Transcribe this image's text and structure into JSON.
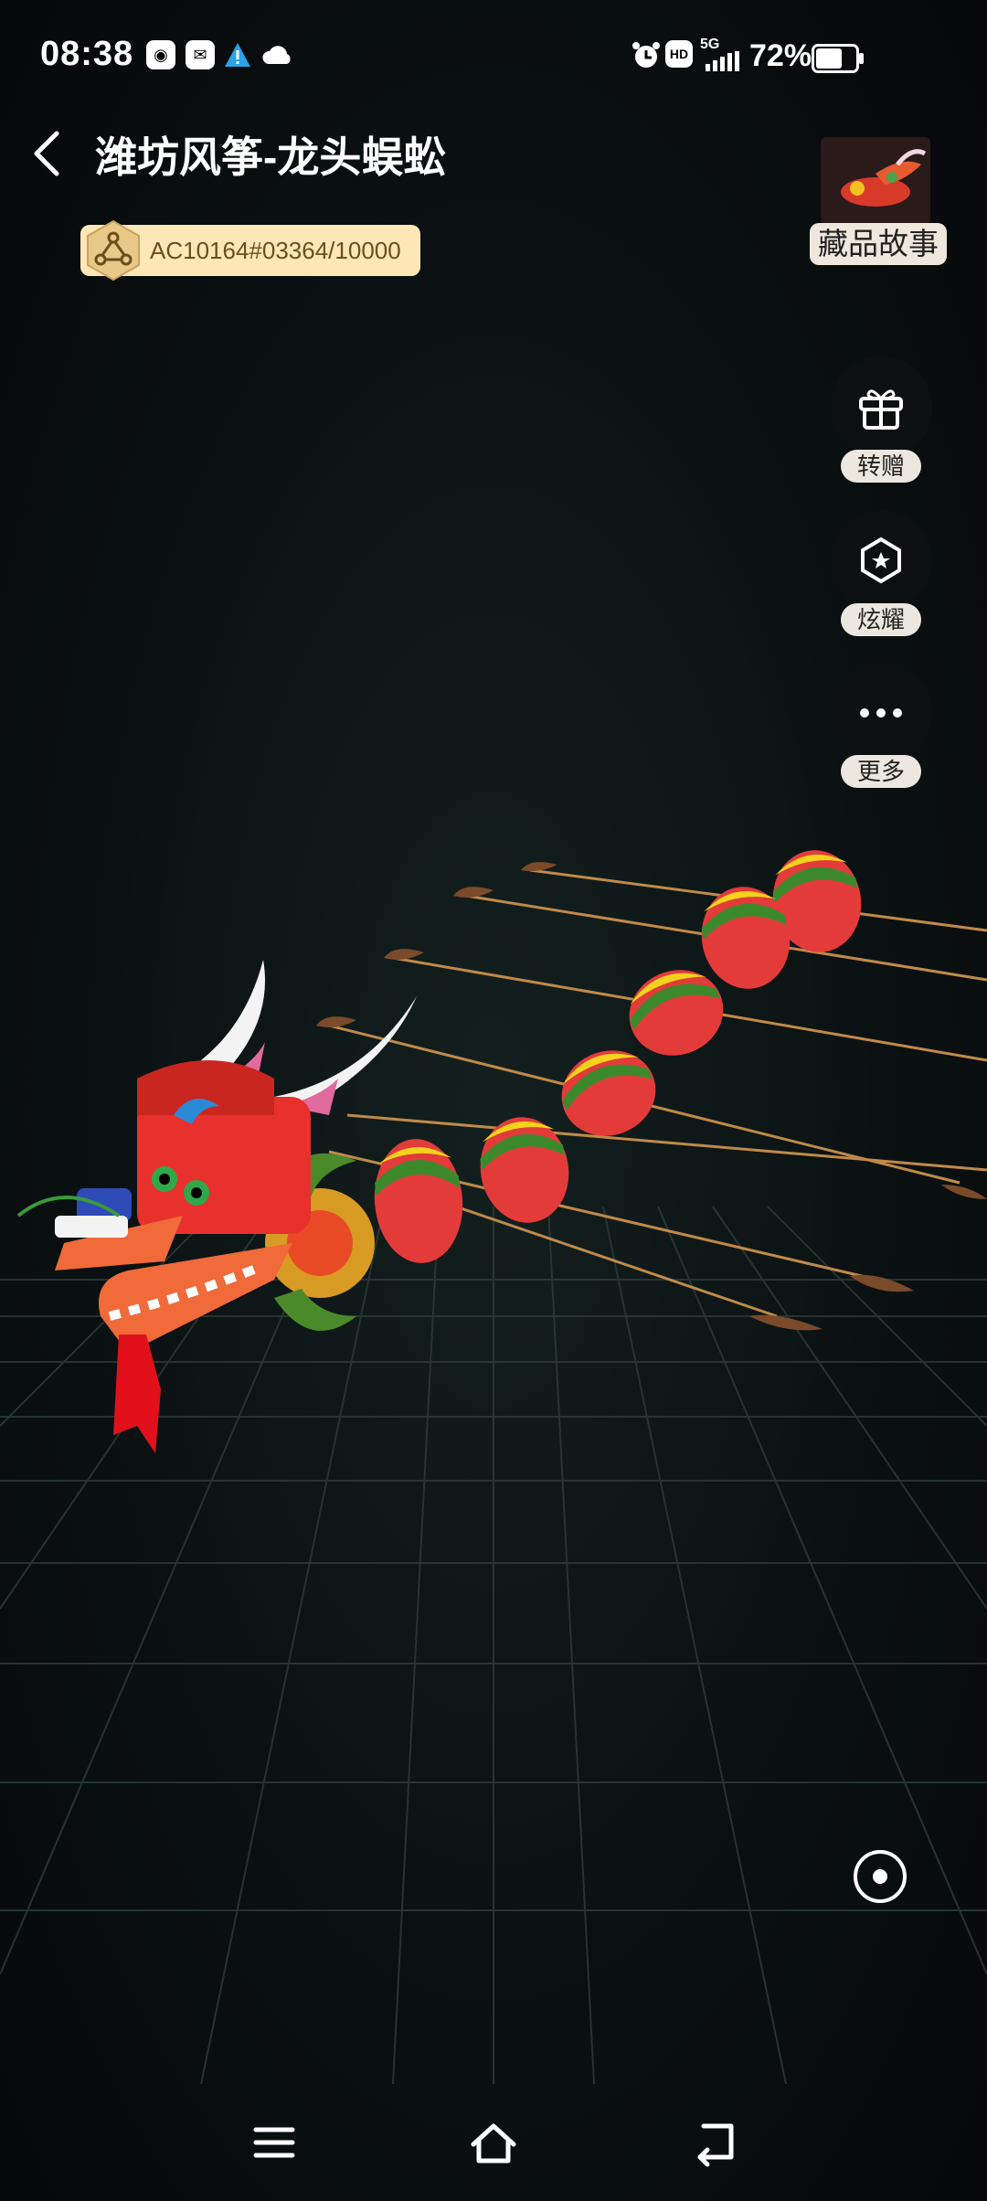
{
  "status_bar": {
    "time": "08:38",
    "network": "5G",
    "battery_percent": "72%",
    "icons": [
      "qq-icon",
      "message-icon",
      "alert-icon",
      "cloud-icon",
      "alarm-icon",
      "hd-icon",
      "signal-icon",
      "battery-icon"
    ]
  },
  "header": {
    "back_icon": "chevron-left-icon",
    "title": "潍坊风筝-龙头蜈蚣"
  },
  "serial_badge": {
    "icon": "hex-network-icon",
    "text": "AC10164#03364/10000"
  },
  "story": {
    "label": "藏品故事"
  },
  "actions": [
    {
      "icon": "gift-icon",
      "label": "转赠"
    },
    {
      "icon": "badge-star-icon",
      "label": "炫耀"
    },
    {
      "icon": "more-dots-icon",
      "label": "更多"
    }
  ],
  "locate_icon": "locate-icon",
  "nav_bar": {
    "icons": [
      "menu-icon",
      "home-icon",
      "back-icon"
    ]
  },
  "colors": {
    "badge_bg": "#fde7b7",
    "dragon_red": "#e8302c",
    "lantern_green": "#3d8a2d",
    "lantern_yellow": "#f2d21c",
    "horn_white": "#f3f3f3"
  }
}
